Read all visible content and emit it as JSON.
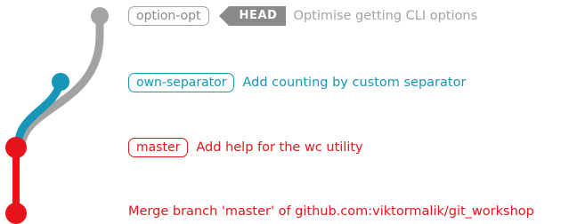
{
  "colors": {
    "gray": "#a3a3a3",
    "head_bg": "#8a8a8a",
    "blue": "#1796b8",
    "red": "#e8141c"
  },
  "commits": [
    {
      "branch": "option-opt",
      "head": "HEAD",
      "message": "Optimise getting CLI options",
      "color": "gray"
    },
    {
      "branch": "own-separator",
      "message": "Add counting by custom separator",
      "color": "blue"
    },
    {
      "branch": "master",
      "message": "Add help for the wc utility",
      "color": "red"
    },
    {
      "message": "Merge branch 'master' of github.com:viktormalik/git_workshop",
      "color": "red"
    }
  ]
}
